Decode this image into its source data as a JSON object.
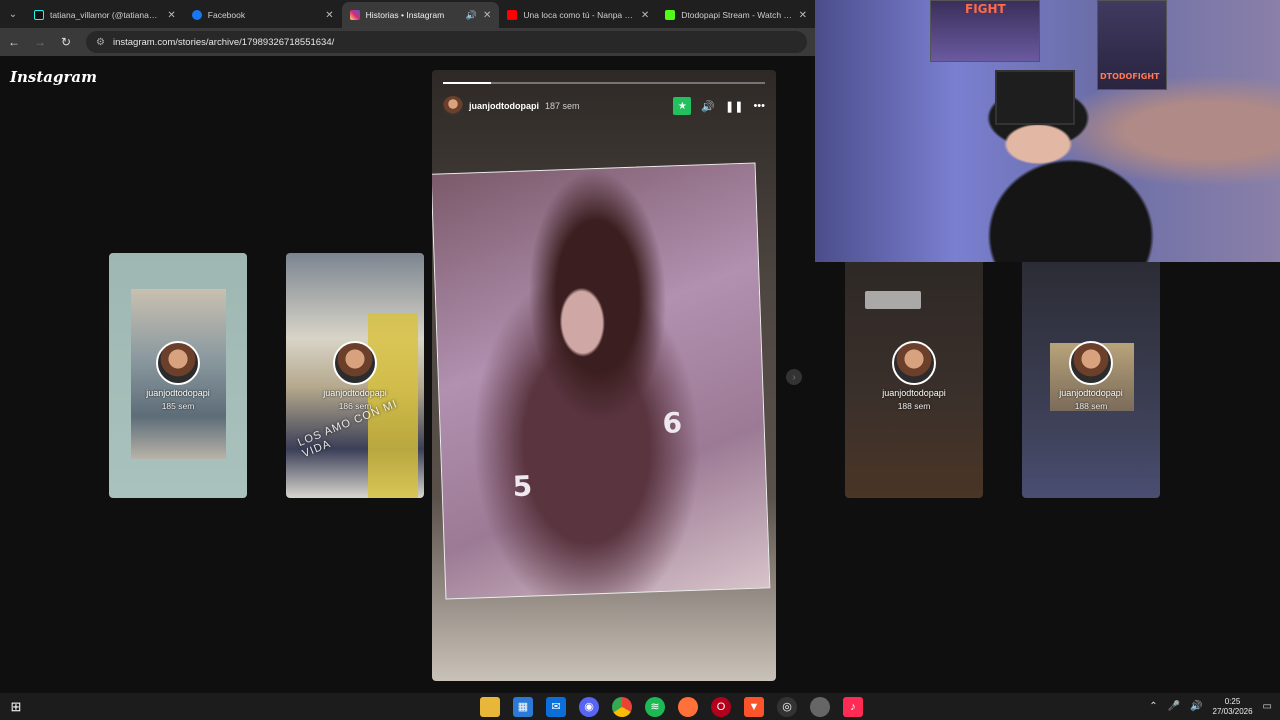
{
  "browser": {
    "tabs": [
      {
        "title": "tatiana_villamor (@tatiana_villa...",
        "color": "#111111",
        "active": false
      },
      {
        "title": "Facebook",
        "color": "#1877f2",
        "active": false
      },
      {
        "title": "Historias • Instagram",
        "color": "#d62976",
        "active": true
      },
      {
        "title": "Una loca como tú - Nanpa Básic...",
        "color": "#ff0000",
        "active": false
      },
      {
        "title": "Dtodopapi Stream - Watch Live...",
        "color": "#53fc18",
        "active": false
      }
    ],
    "url": "instagram.com/stories/archive/17989326718551634/"
  },
  "instagram": {
    "logo": "Instagram",
    "story": {
      "username": "juanjodtodopapi",
      "time": "187 sem",
      "progress": 0.15,
      "jersey_numbers": [
        "5",
        "6"
      ]
    },
    "side_cards": [
      {
        "username": "juanjodtodopapi",
        "time": "185 sem",
        "overlay": ""
      },
      {
        "username": "juanjodtodopapi",
        "time": "186 sem",
        "overlay": "LOS AMO CON MI VIDA"
      },
      {
        "username": "juanjodtodopapi",
        "time": "188 sem",
        "overlay": ""
      },
      {
        "username": "juanjodtodopapi",
        "time": "188 sem",
        "overlay": ""
      }
    ]
  },
  "webcam": {
    "poster_text": "DTODOFIGHT",
    "top_poster_text": "FIGHT"
  },
  "taskbar": {
    "time": "0:25",
    "date": "27/03/2026"
  }
}
